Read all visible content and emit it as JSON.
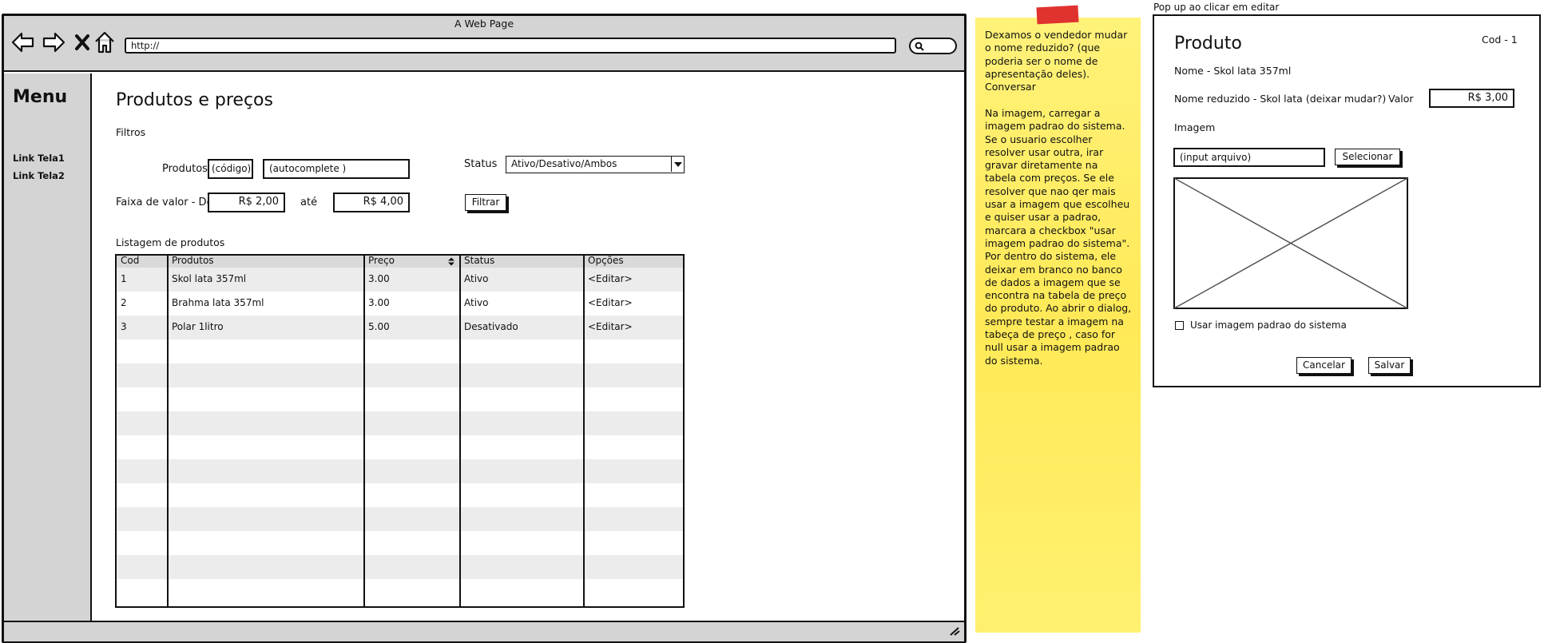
{
  "browser": {
    "title": "A Web Page",
    "url": "http://",
    "nav_icons": [
      "back-arrow-icon",
      "forward-arrow-icon",
      "close-icon",
      "home-icon"
    ]
  },
  "sidebar": {
    "title": "Menu",
    "links": [
      {
        "label": "Link Tela1"
      },
      {
        "label": "Link Tela2"
      }
    ]
  },
  "main": {
    "title": "Produtos e preços",
    "filters_label": "Filtros",
    "produtos_label": "Produtos",
    "codigo_value": "(código)",
    "autocomplete_value": "(autocomplete )",
    "status_label": "Status",
    "status_value": "Ativo/Desativo/Ambos",
    "faixa_label": "Faixa de valor - De",
    "de_value": "R$ 2,00",
    "ate_label": "até",
    "ate_value": "R$ 4,00",
    "filtrar_button": "Filtrar",
    "listing_label": "Listagem de produtos",
    "table": {
      "headers": [
        "Cod",
        "Produtos",
        "Preço",
        "Status",
        "Opções"
      ],
      "rows": [
        [
          "1",
          "Skol lata 357ml",
          "3.00",
          "Ativo",
          "<Editar>"
        ],
        [
          "2",
          "Brahma lata 357ml",
          "3.00",
          "Ativo",
          "<Editar>"
        ],
        [
          "3",
          "Polar 1litro",
          "5.00",
          "Desativado",
          "<Editar>"
        ]
      ]
    }
  },
  "note": {
    "text_1": "Dexamos o vendedor mudar o nome reduzido? (que poderia ser o nome de apresentação deles). Conversar",
    "text_2": "Na imagem, carregar a imagem padrao do sistema. Se o usuario escolher resolver usar outra, irar gravar diretamente na tabela com preços. Se ele resolver que nao qer mais usar a imagem que escolheu e quiser usar a padrao, marcara a checkbox \"usar imagem padrao do sistema\". Por dentro do sistema, ele deixar em branco no banco de dados a imagem que se encontra na tabela de preço do produto. Ao abrir o dialog, sempre testar a imagem na tabeça de preço , caso for null usar a imagem padrao do sistema."
  },
  "popup": {
    "caption": "Pop up ao clicar em editar",
    "title": "Produto",
    "cod": "Cod - 1",
    "nome": "Nome - Skol lata 357ml",
    "nome_reduzido": "Nome reduzido - Skol lata  (deixar mudar?)",
    "valor_label": "Valor",
    "valor_value": "R$ 3,00",
    "imagem_label": "Imagem",
    "input_arquivo": "(input arquivo)",
    "selecionar_button": "Selecionar",
    "checkbox_label": "Usar imagem padrao do sistema",
    "cancelar_button": "Cancelar",
    "salvar_button": "Salvar"
  }
}
